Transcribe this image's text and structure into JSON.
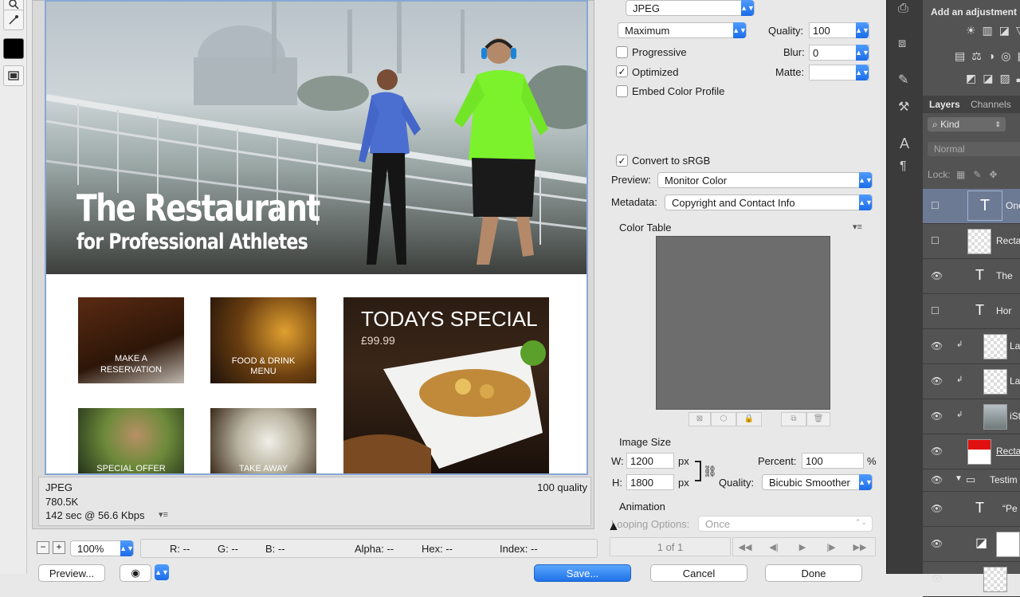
{
  "preview": {
    "hero_title": "The Restaurant",
    "hero_subtitle": "for Professional Athletes",
    "tiles": [
      {
        "label": "MAKE A\nRESERVATION"
      },
      {
        "label": "FOOD & DRINK\nMENU"
      },
      {
        "label": "SPECIAL OFFER"
      },
      {
        "label": "TAKE AWAY"
      }
    ],
    "special_title": "TODAYS SPECIAL",
    "special_price": "£99.99"
  },
  "info": {
    "format": "JPEG",
    "size": "780.5K",
    "time": "142 sec @ 56.6 Kbps",
    "quality": "100 quality"
  },
  "statusbar": {
    "zoom": "100%",
    "r": "R: --",
    "g": "G: --",
    "b": "B: --",
    "alpha": "Alpha: --",
    "hex": "Hex: --",
    "index": "Index: --"
  },
  "settings": {
    "format": "JPEG",
    "compression": "Maximum",
    "quality_label": "Quality:",
    "quality_value": "100",
    "progressive": "Progressive",
    "blur_label": "Blur:",
    "blur_value": "0",
    "optimized": "Optimized",
    "matte_label": "Matte:",
    "embed_profile": "Embed Color Profile",
    "convert_srgb": "Convert to sRGB",
    "preview_label": "Preview:",
    "preview_value": "Monitor Color",
    "metadata_label": "Metadata:",
    "metadata_value": "Copyright and Contact Info",
    "color_table": "Color Table",
    "image_size": "Image Size",
    "w_label": "W:",
    "w_value": "1200",
    "h_label": "H:",
    "h_value": "1800",
    "px": "px",
    "percent_label": "Percent:",
    "percent_value": "100",
    "percent_unit": "%",
    "quality2_label": "Quality:",
    "resample": "Bicubic Smoother",
    "animation": "Animation",
    "looping_label": "Looping Options:",
    "looping_value": "Once",
    "frame": "1 of 1"
  },
  "buttons": {
    "preview": "Preview...",
    "save": "Save...",
    "cancel": "Cancel",
    "done": "Done"
  },
  "right": {
    "adjustment_title": "Add an adjustment",
    "tab_layers": "Layers",
    "tab_channels": "Channels",
    "kind": "Kind",
    "blend": "Normal",
    "lock": "Lock:",
    "layers": [
      {
        "name": "One",
        "type": "text",
        "visible": false
      },
      {
        "name": "Recta",
        "type": "shape",
        "visible": false
      },
      {
        "name": "The",
        "type": "text",
        "visible": true
      },
      {
        "name": "Hor",
        "type": "text",
        "visible": false
      },
      {
        "name": "La",
        "type": "image",
        "visible": true
      },
      {
        "name": "La",
        "type": "image",
        "visible": true
      },
      {
        "name": "iSt",
        "type": "image",
        "visible": true
      },
      {
        "name": "Recta",
        "type": "shape",
        "visible": false
      },
      {
        "name": "Testim",
        "type": "group",
        "visible": true
      },
      {
        "name": "“Pe",
        "type": "text",
        "visible": true
      },
      {
        "name": "",
        "type": "adjust",
        "visible": true
      },
      {
        "name": "",
        "type": "image",
        "visible": true
      }
    ]
  }
}
